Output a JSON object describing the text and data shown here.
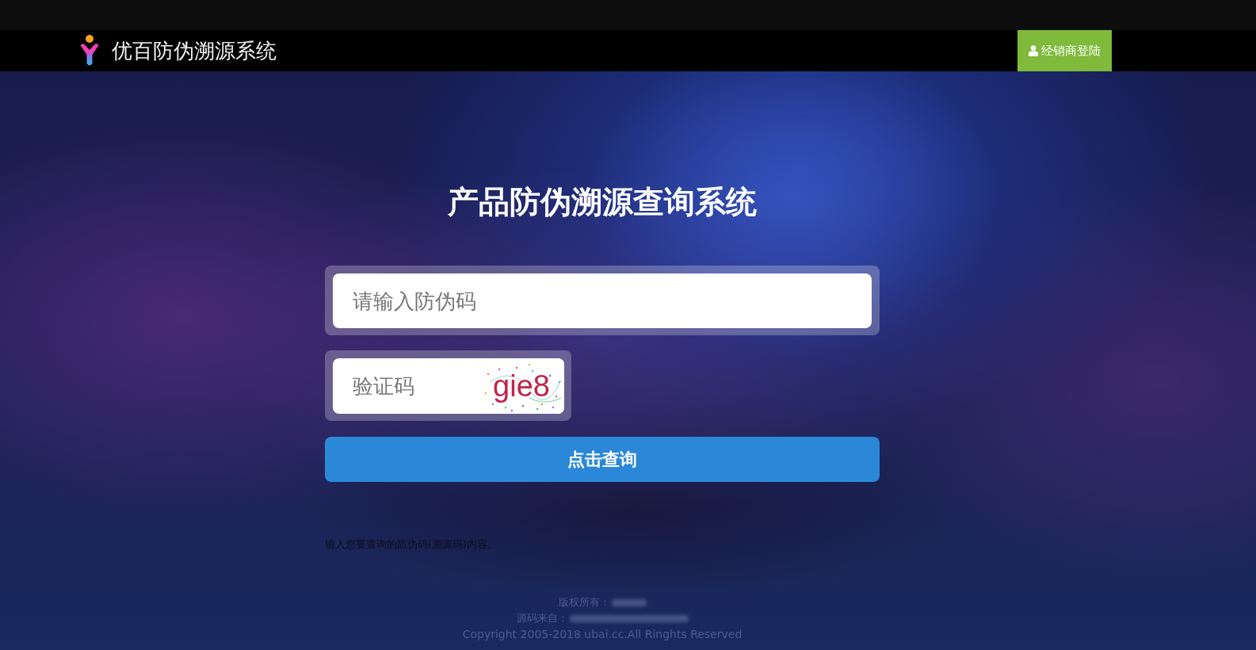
{
  "header": {
    "brand": "优百防伪溯源系统",
    "login_button": "经销商登陆"
  },
  "title": "产品防伪溯源查询系统",
  "code_field": {
    "placeholder": "请输入防伪码"
  },
  "captcha_field": {
    "placeholder": "验证码",
    "captcha": "gie8"
  },
  "submit_button": "点击查询",
  "hint": "输入您要查询的防伪码(溯源码)内容。",
  "footer": {
    "lines": [
      {
        "label": "版权所有：",
        "redacted": true
      },
      {
        "label": "源码来自：",
        "redacted": true
      }
    ],
    "copyright": "Copyright 2005-2018 ubai.cc.All Ringhts Reserved"
  }
}
